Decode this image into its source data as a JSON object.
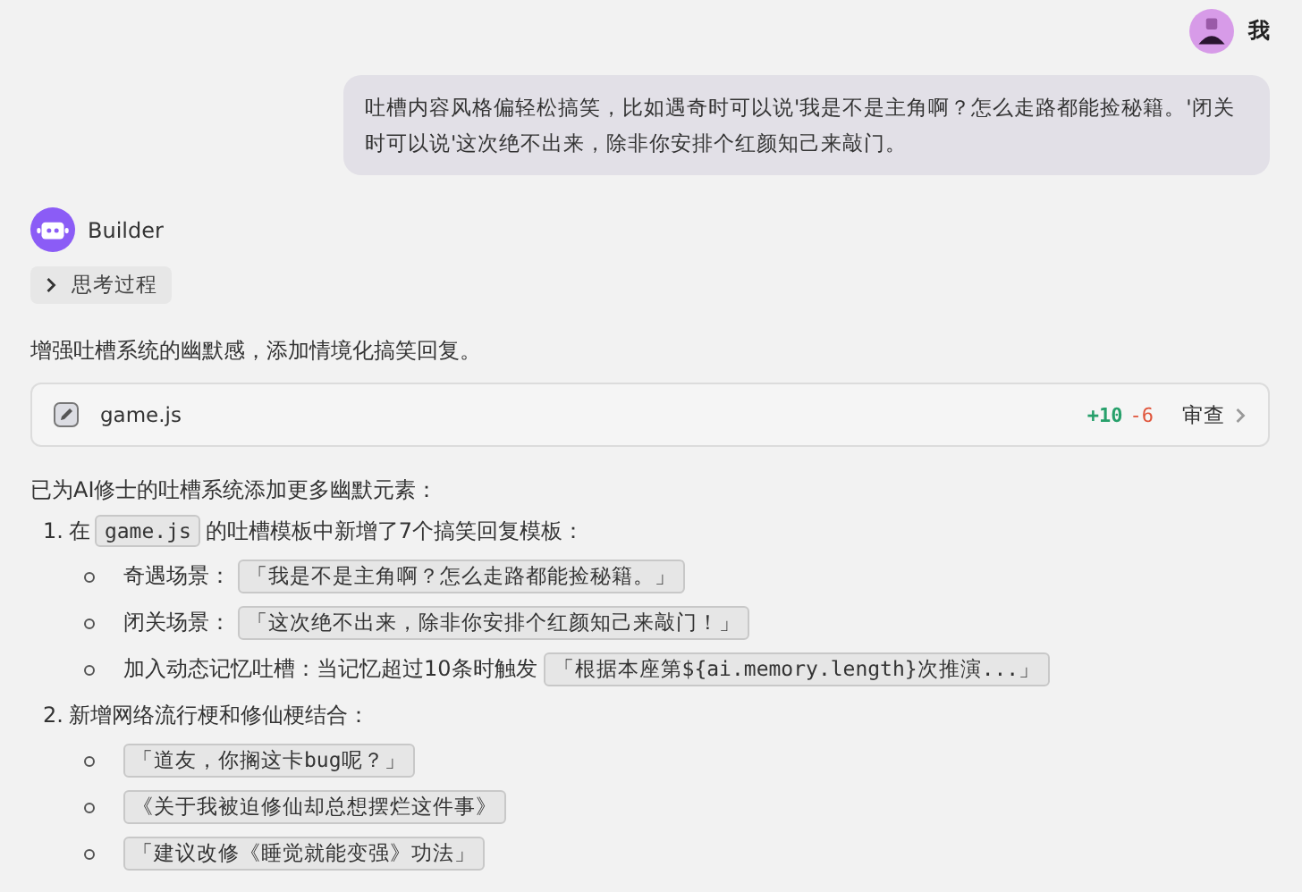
{
  "user": {
    "name": "我",
    "message": "吐槽内容风格偏轻松搞笑，比如遇奇时可以说'我是不是主角啊？怎么走路都能捡秘籍。'闭关时可以说'这次绝不出来，除非你安排个红颜知己来敲门。"
  },
  "assistant": {
    "name": "Builder",
    "thinking": {
      "label": "思考过程",
      "expanded": false
    },
    "intro": "增强吐槽系统的幽默感，添加情境化搞笑回复。",
    "file_change": {
      "filename": "game.js",
      "added": "+10",
      "removed": "-6",
      "action": "审查"
    },
    "summary": "已为AI修士的吐槽系统添加更多幽默元素：",
    "steps": [
      {
        "number": "1.",
        "parts": [
          {
            "kind": "text",
            "text": "在"
          },
          {
            "kind": "code",
            "text": "game.js"
          },
          {
            "kind": "text",
            "text": "的吐槽模板中新增了7个搞笑回复模板："
          }
        ],
        "children": [
          {
            "parts": [
              {
                "kind": "text",
                "text": "奇遇场景："
              },
              {
                "kind": "code",
                "text": "「我是不是主角啊？怎么走路都能捡秘籍。」"
              }
            ]
          },
          {
            "parts": [
              {
                "kind": "text",
                "text": "闭关场景："
              },
              {
                "kind": "code",
                "text": "「这次绝不出来，除非你安排个红颜知己来敲门！」"
              }
            ]
          },
          {
            "parts": [
              {
                "kind": "text",
                "text": "加入动态记忆吐槽：当记忆超过10条时触发"
              },
              {
                "kind": "code",
                "text": "「根据本座第${ai.memory.length}次推演...」"
              }
            ]
          }
        ]
      },
      {
        "number": "2.",
        "parts": [
          {
            "kind": "text",
            "text": "新增网络流行梗和修仙梗结合："
          }
        ],
        "children": [
          {
            "parts": [
              {
                "kind": "code",
                "text": "「道友，你搁这卡bug呢？」"
              }
            ]
          },
          {
            "parts": [
              {
                "kind": "code",
                "text": "《关于我被迫修仙却总想摆烂这件事》"
              }
            ]
          },
          {
            "parts": [
              {
                "kind": "code",
                "text": "「建议改修《睡觉就能变强》功法」"
              }
            ]
          }
        ]
      }
    ]
  }
}
